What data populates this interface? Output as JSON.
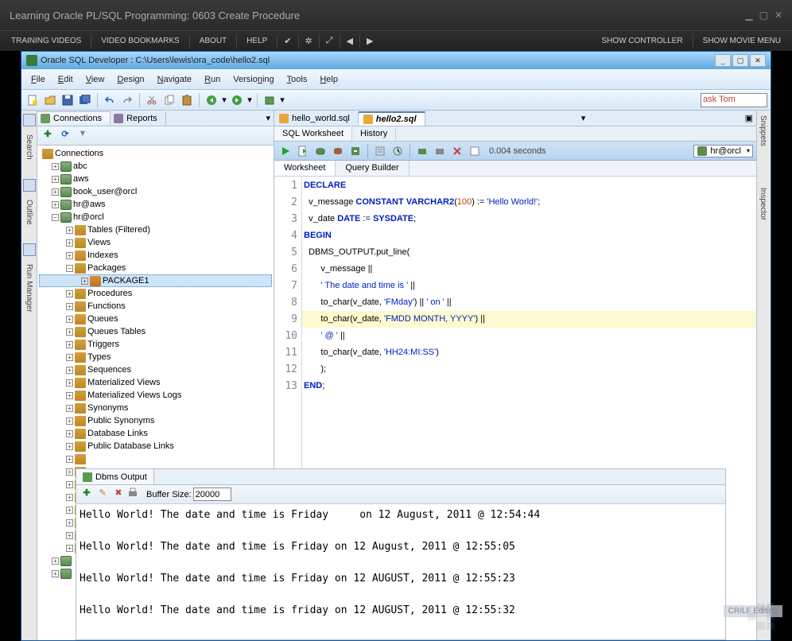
{
  "outer": {
    "title": "Learning Oracle PL/SQL Programming: 0603 Create Procedure",
    "menu": [
      "TRAINING VIDEOS",
      "VIDEO BOOKMARKS",
      "ABOUT",
      "HELP"
    ],
    "menu_right": [
      "SHOW CONTROLLER",
      "SHOW MOVIE MENU"
    ]
  },
  "sqlDev": {
    "title": "Oracle SQL Developer : C:\\Users\\lewis\\ora_code\\hello2.sql",
    "menu": [
      "File",
      "Edit",
      "View",
      "Design",
      "Navigate",
      "Run",
      "Versioning",
      "Tools",
      "Help"
    ],
    "askTom": "ask Tom"
  },
  "leftRail": {
    "search": "Search",
    "outline": "Outline",
    "runmgr": "Run Manager"
  },
  "connPanel": {
    "tabs": {
      "conn": "Connections",
      "rep": "Reports"
    },
    "root": "Connections",
    "dbs": [
      "abc",
      "aws",
      "book_user@orcl",
      "hr@aws",
      "hr@orcl"
    ],
    "folders": [
      "Tables (Filtered)",
      "Views",
      "Indexes",
      "Packages"
    ],
    "package1": "PACKAGE1",
    "foldersAfter": [
      "Procedures",
      "Functions",
      "Queues",
      "Queues Tables",
      "Triggers",
      "Types",
      "Sequences",
      "Materialized Views",
      "Materialized Views Logs",
      "Synonyms",
      "Public Synonyms",
      "Database Links",
      "Public Database Links"
    ]
  },
  "editor": {
    "fileTabs": [
      "hello_world.sql",
      "hello2.sql"
    ],
    "subTabs": [
      "SQL Worksheet",
      "History"
    ],
    "wsTabs": [
      "Worksheet",
      "Query Builder"
    ],
    "timing": "0.004 seconds",
    "connSelect": "hr@orcl",
    "code": {
      "l1": "DECLARE",
      "l2a": "  v_message ",
      "l2b": "CONSTANT",
      "l2c": " VARCHAR2",
      "l2d": "(",
      "l2e": "100",
      "l2f": ")",
      "l2g": " := ",
      "l2h": "'Hello World!'",
      "l2i": ";",
      "l3a": "  v_date ",
      "l3b": "DATE",
      "l3c": " := ",
      "l3d": "SYSDATE",
      "l3e": ";",
      "l4": "BEGIN",
      "l5": "  DBMS_OUTPUT.put_line(",
      "l6": "       v_message || ",
      "l7a": "       ",
      "l7b": "' The date and time is '",
      "l7c": " || ",
      "l8a": "       to_char(v_date, ",
      "l8b": "'FMday'",
      "l8c": ") || ",
      "l8d": "' on '",
      "l8e": " || ",
      "l9a": "       to_char(v_date, ",
      "l9b": "'FMDD MONTH, YYYY'",
      "l9c": ") || ",
      "l10a": "       ",
      "l10b": "' @ '",
      "l10c": " || ",
      "l11a": "       to_char(v_date, ",
      "l11b": "'HH24:MI:SS'",
      "l11c": ")",
      "l12": "       );",
      "l13a": "END",
      "l13b": ";"
    }
  },
  "output": {
    "tab": "Dbms Output",
    "bufferLabel": "Buffer Size:",
    "bufferVal": "20000",
    "lines": [
      "Hello World! The date and time is Friday     on 12 August, 2011 @ 12:54:44",
      "",
      "Hello World! The date and time is Friday on 12 August, 2011 @ 12:55:05",
      "",
      "Hello World! The date and time is Friday on 12 AUGUST, 2011 @ 12:55:23",
      "",
      "Hello World! The date and time is friday on 12 AUGUST, 2011 @ 12:55:32"
    ]
  },
  "rightRail": {
    "snippets": "Snippets",
    "inspector": "Inspector"
  },
  "status": "CR/LF  Editing"
}
